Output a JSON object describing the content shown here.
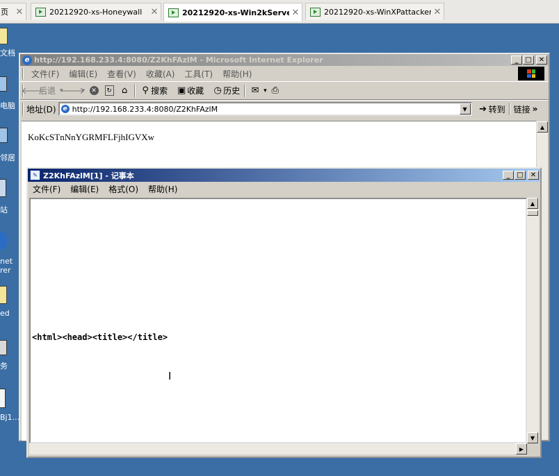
{
  "vm_tabs": [
    {
      "label": "页",
      "close": "✕"
    },
    {
      "label": "20212920-xs-Honeywall",
      "close": "✕"
    },
    {
      "label": "20212920-xs-Win2kServe...",
      "close": "✕"
    },
    {
      "label": "20212920-xs-WinXPattacker",
      "close": "✕"
    }
  ],
  "desktop_icons": [
    {
      "label": "文档",
      "icon": "folder-icon"
    },
    {
      "label": "电脑",
      "icon": "computer-icon"
    },
    {
      "label": "邻居",
      "icon": "network-icon"
    },
    {
      "label": "站",
      "icon": "recycle-icon"
    },
    {
      "label": "net",
      "icon": "ie-icon"
    },
    {
      "label": "rer",
      "icon": "ie-icon"
    },
    {
      "label": "ed",
      "icon": "folder-icon"
    },
    {
      "label": "务",
      "icon": "gear-icon"
    },
    {
      "label": "Bj1...",
      "icon": "file-icon"
    }
  ],
  "ie": {
    "title": "http://192.168.233.4:8080/Z2KhFAzlM - Microsoft Internet Explorer",
    "menu": [
      "文件(F)",
      "编辑(E)",
      "查看(V)",
      "收藏(A)",
      "工具(T)",
      "帮助(H)"
    ],
    "toolbar": {
      "back": "后退",
      "search": "搜索",
      "favorites": "收藏",
      "history": "历史"
    },
    "address_label": "地址(D)",
    "address_value": "http://192.168.233.4:8080/Z2KhFAzlM",
    "go_label": "转到",
    "links_label": "链接",
    "page_text": "KoKcSTnNnYGRMFLFjhIGVXw"
  },
  "notepad": {
    "title": "Z2KhFAzlM[1] - 记事本",
    "menu": [
      "文件(F)",
      "编辑(E)",
      "格式(O)",
      "帮助(H)"
    ],
    "content_line": "<html><head><title></title>"
  },
  "window_buttons": {
    "min": "_",
    "max": "□",
    "close": "✕"
  }
}
